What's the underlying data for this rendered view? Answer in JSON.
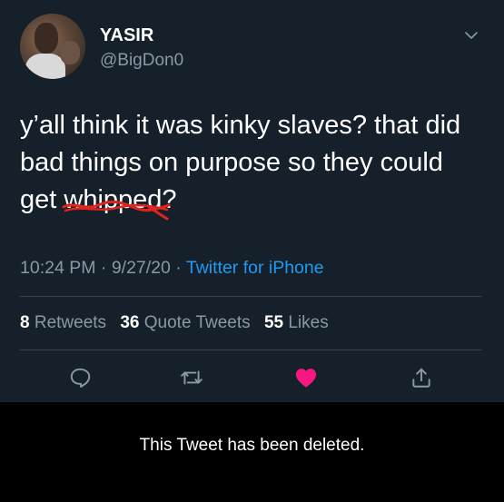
{
  "user": {
    "name": "YASIR",
    "handle": "@BigDon0"
  },
  "tweet": {
    "text_line1": "y’all think it was kinky slaves? that did",
    "text_line2": "bad things on purpose so they could",
    "text_line3_prefix": "get ",
    "text_line3_struck": "whipped",
    "text_line3_suffix": "?",
    "time": "10:24 PM",
    "sep": " · ",
    "date": "9/27/20",
    "source": "Twitter for iPhone"
  },
  "stats": {
    "retweets_count": "8",
    "retweets_label": "Retweets",
    "quotes_count": "36",
    "quotes_label": "Quote Tweets",
    "likes_count": "55",
    "likes_label": "Likes"
  },
  "actions": {
    "reply_icon": "reply-icon",
    "retweet_icon": "retweet-icon",
    "like_icon": "heart-icon",
    "share_icon": "share-icon",
    "liked": true
  },
  "notice": {
    "deleted_text": "This Tweet has been deleted."
  },
  "colors": {
    "background": "#15202b",
    "link": "#1d9bf0",
    "like": "#f91880",
    "secondary_text": "#8b98a5",
    "scribble": "#e0241b"
  }
}
